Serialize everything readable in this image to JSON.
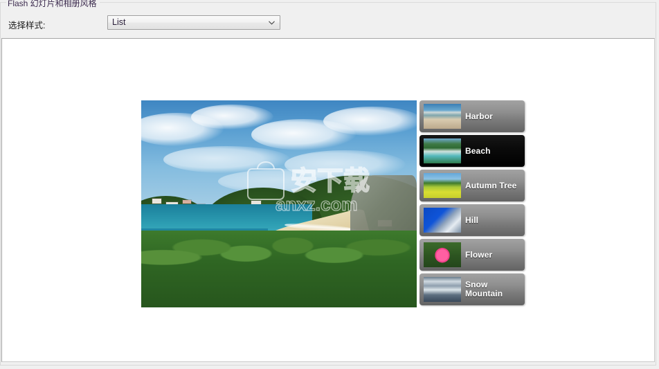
{
  "groupbox": {
    "title": "Flash 幻灯片和相册风格"
  },
  "style_row": {
    "label": "选择样式:",
    "select": {
      "value": "List",
      "arrow_icon": "chevron-down-icon",
      "options": [
        "List"
      ]
    }
  },
  "preview": {
    "alt": "beach-coastline-photo",
    "watermark": {
      "primary": "安下载",
      "secondary": "anxz.com"
    }
  },
  "thumbnails": {
    "items": [
      {
        "label": "Harbor",
        "selected": false,
        "art": "t-harbor"
      },
      {
        "label": "Beach",
        "selected": true,
        "art": "t-beach"
      },
      {
        "label": "Autumn Tree",
        "selected": false,
        "art": "t-autumn"
      },
      {
        "label": "Hill",
        "selected": false,
        "art": "t-hill"
      },
      {
        "label": "Flower",
        "selected": false,
        "art": "t-flower"
      },
      {
        "label": "Snow Mountain",
        "selected": false,
        "art": "t-snow"
      }
    ]
  },
  "colors": {
    "window_bg": "#f0f0f0",
    "panel_bg": "#ffffff",
    "panel_border": "#a6a6a6",
    "title_text": "#3b2a4d",
    "item_bg_top": "#a2a2a2",
    "item_bg_bottom": "#636363",
    "item_selected_bg": "#000000",
    "item_label": "#ffffff"
  }
}
